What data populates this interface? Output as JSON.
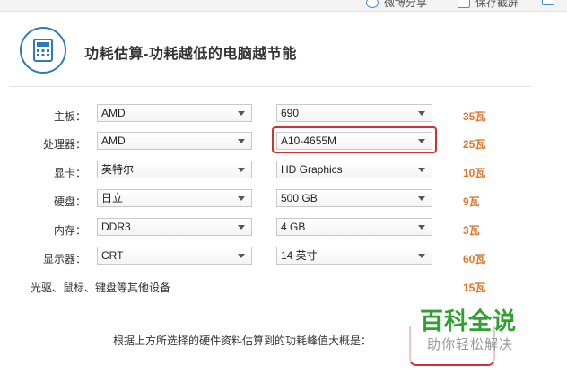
{
  "toolbar": {
    "share_label": "微博分享",
    "screenshot_label": "保存截屏"
  },
  "header": {
    "title": "功耗估算-功耗越低的电脑越节能",
    "icon": "calculator-icon"
  },
  "rows": [
    {
      "label": "主板",
      "brand": "AMD",
      "model": "690",
      "watt": "35瓦"
    },
    {
      "label": "处理器",
      "brand": "AMD",
      "model": "A10-4655M",
      "watt": "25瓦"
    },
    {
      "label": "显卡",
      "brand": "英特尔",
      "model": "HD Graphics",
      "watt": "10瓦"
    },
    {
      "label": "硬盘",
      "brand": "日立",
      "model": "500 GB",
      "watt": "9瓦"
    },
    {
      "label": "内存",
      "brand": "DDR3",
      "model": "4 GB",
      "watt": "3瓦"
    },
    {
      "label": "显示器",
      "brand": "CRT",
      "model": "14 英寸",
      "watt": "60瓦"
    }
  ],
  "peripherals": {
    "label": "光驱、鼠标、键盘等其他设备",
    "watt": "15瓦"
  },
  "summary": {
    "label": "根据上方所选择的硬件资料估算到的功耗峰值大概是："
  },
  "watermark": {
    "title": "百科全说",
    "subtitle": "助你轻松解决"
  },
  "colors": {
    "accent": "#2f7ab9",
    "watt": "#e0762f",
    "highlight": "#cc3333",
    "watermark": "#2ea12e"
  }
}
